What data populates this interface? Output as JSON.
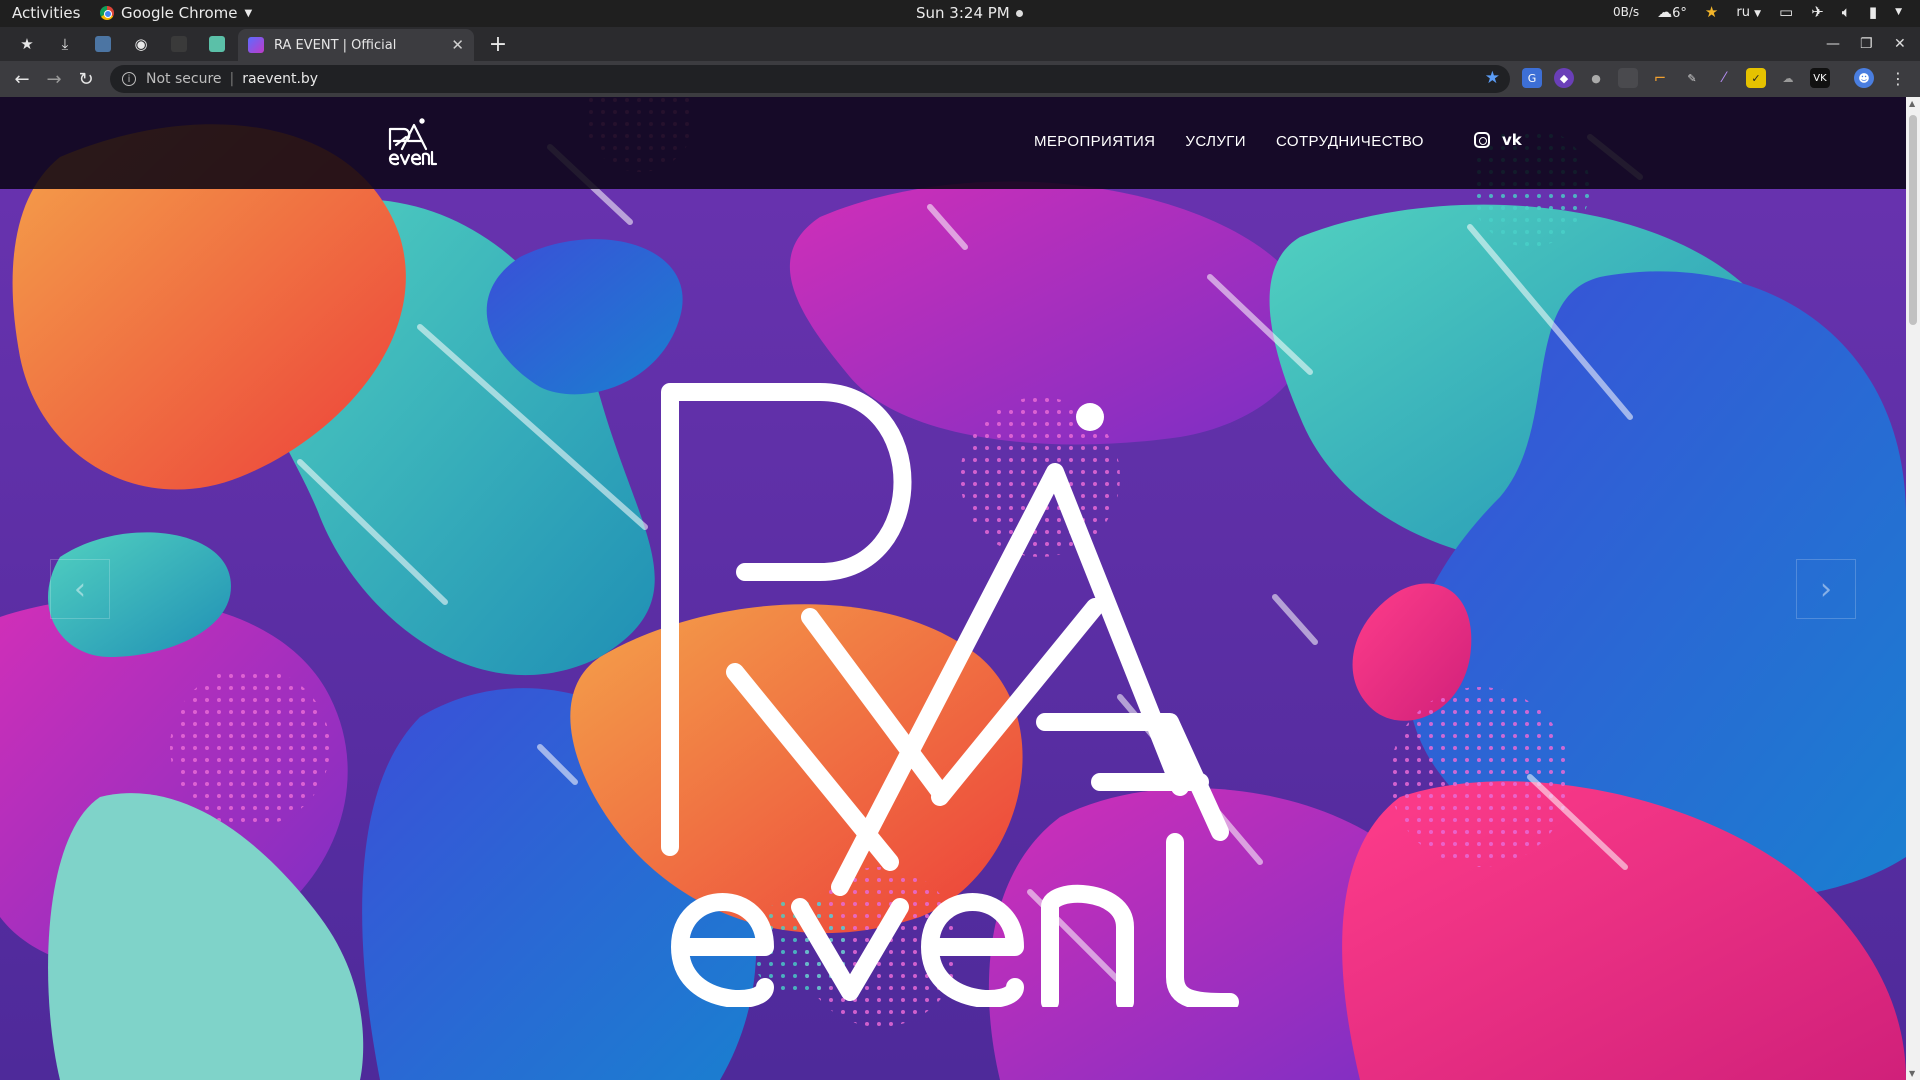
{
  "os_topbar": {
    "activities": "Activities",
    "app_name": "Google Chrome",
    "clock": "Sun  3:24 PM",
    "net_speed": "0B/s",
    "weather": "6°",
    "language": "ru"
  },
  "browser": {
    "tab_title": "RA EVENT | Official",
    "new_tab": "+",
    "security_label": "Not secure",
    "url": "raevent.by"
  },
  "site": {
    "nav": [
      "МЕРОПРИЯТИЯ",
      "УСЛУГИ",
      "СОТРУДНИЧЕСТВО"
    ],
    "logo_text": "RA event"
  },
  "colors": {
    "accent_blue": "#5b9cf5",
    "header_bg": "#0a0612",
    "page_purple": "#5a2f9a"
  }
}
